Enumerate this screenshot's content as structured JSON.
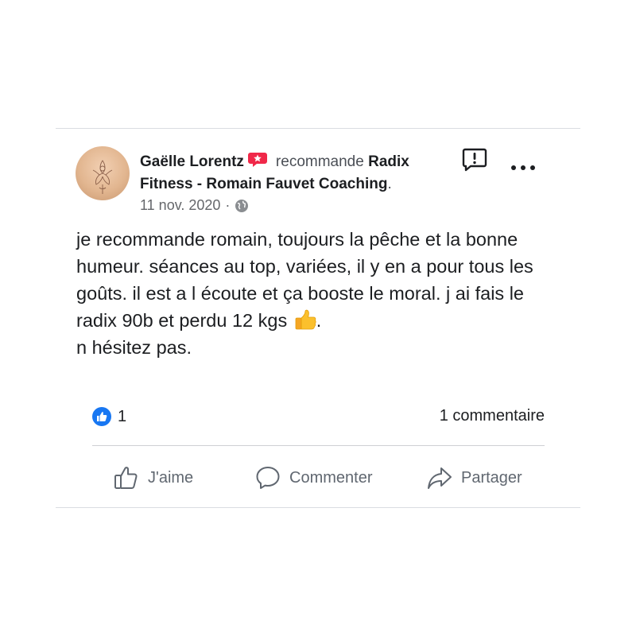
{
  "post": {
    "author": "Gaëlle Lorentz",
    "verb": "recommande",
    "page": "Radix Fitness - Romain Fauvet Coaching",
    "page_suffix": ".",
    "date": "11 nov. 2020",
    "separator": "·",
    "text_before_emoji": "je recommande romain, toujours la pêche et la bonne humeur. séances au top, variées, il y en a pour tous les goûts. il est a l écoute et ça booste le moral. j ai fais le radix 90b et perdu 12 kgs ",
    "text_after_emoji": ".\nn hésitez pas.",
    "emoji": "thumbs-up-emoji"
  },
  "engagement": {
    "reaction_count": "1",
    "reaction_type": "like-icon",
    "comments_label": "1 commentaire"
  },
  "actions": {
    "like_label": "J'aime",
    "comment_label": "Commenter",
    "share_label": "Partager"
  },
  "icons": {
    "recommend": "recommend-badge-icon",
    "privacy": "globe-icon",
    "report": "report-icon",
    "more": "more-options-icon"
  },
  "colors": {
    "like_blue": "#1877f2",
    "recommend_red": "#f02849",
    "action_gray": "#606770",
    "divider": "#ced0d4"
  }
}
